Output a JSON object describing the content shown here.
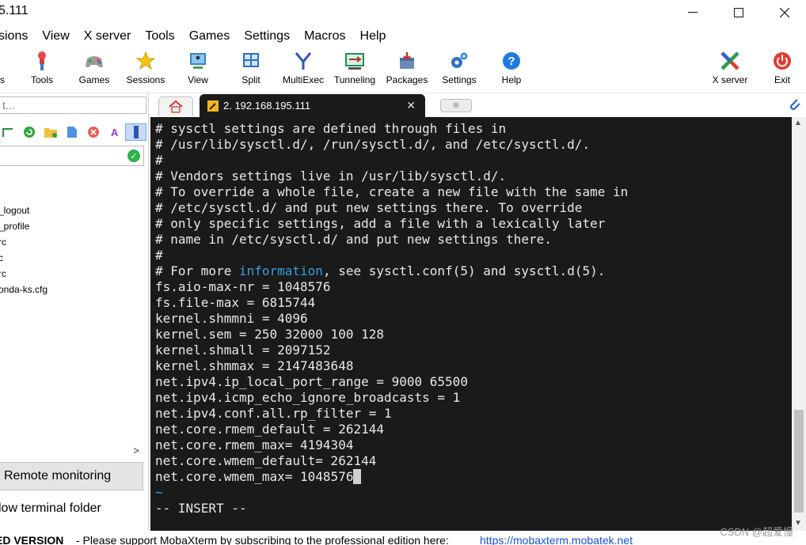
{
  "window": {
    "title": "5.111"
  },
  "menu": [
    "sions",
    "View",
    "X server",
    "Tools",
    "Games",
    "Settings",
    "Macros",
    "Help"
  ],
  "toolbar": {
    "items": [
      {
        "label": "rs",
        "icon": "servers-icon"
      },
      {
        "label": "Tools",
        "icon": "tools-icon"
      },
      {
        "label": "Games",
        "icon": "games-icon"
      },
      {
        "label": "Sessions",
        "icon": "sessions-star-icon"
      },
      {
        "label": "View",
        "icon": "view-icon"
      },
      {
        "label": "Split",
        "icon": "split-icon"
      },
      {
        "label": "MultiExec",
        "icon": "multiexec-icon"
      },
      {
        "label": "Tunneling",
        "icon": "tunneling-icon"
      },
      {
        "label": "Packages",
        "icon": "packages-icon"
      },
      {
        "label": "Settings",
        "icon": "settings-gear-icon"
      },
      {
        "label": "Help",
        "icon": "help-icon"
      }
    ],
    "right": [
      {
        "label": "X server",
        "icon": "x-server-icon"
      },
      {
        "label": "Exit",
        "icon": "exit-power-icon"
      }
    ]
  },
  "sidebar": {
    "quick_connect_placeholder": "t...",
    "files": [
      "_logout",
      "_profile",
      "rc",
      "c",
      "rc",
      "onda-ks.cfg"
    ],
    "remote_monitoring": "Remote monitoring",
    "follow_folder": "low terminal folder"
  },
  "tabs": {
    "active_label": "2. 192.168.195.111",
    "close": "✕"
  },
  "terminal": {
    "lines": [
      "# sysctl settings are defined through files in",
      "# /usr/lib/sysctl.d/, /run/sysctl.d/, and /etc/sysctl.d/.",
      "#",
      "# Vendors settings live in /usr/lib/sysctl.d/.",
      "# To override a whole file, create a new file with the same in",
      "# /etc/sysctl.d/ and put new settings there. To override",
      "# only specific settings, add a file with a lexically later",
      "# name in /etc/sysctl.d/ and put new settings there.",
      "#",
      "fs.aio-max-nr = 1048576",
      "fs.file-max = 6815744",
      "kernel.shmmni = 4096",
      "kernel.sem = 250 32000 100 128",
      "kernel.shmall = 2097152",
      "kernel.shmmax = 2147483648",
      "net.ipv4.ip_local_port_range = 9000 65500",
      "net.ipv4.icmp_echo_ignore_broadcasts = 1",
      "net.ipv4.conf.all.rp_filter = 1",
      "net.core.rmem_default = 262144",
      "net.core.rmem_max= 4194304",
      "net.core.wmem_default= 262144",
      "net.core.wmem_max= 1048576"
    ],
    "info_line": {
      "prefix": "# For more ",
      "keyword": "information",
      "suffix": ", see sysctl.conf(5) and sysctl.d(5)."
    },
    "tilde": "~",
    "mode": "-- INSERT --"
  },
  "status": {
    "bold": "ED VERSION",
    "message": "-  Please support MobaXterm by subscribing to the professional edition here:",
    "link": "https://mobaxterm.mobatek.net"
  },
  "watermark": "CSDN @超爱慢",
  "colors": {
    "terminal_bg": "#1a1a1a",
    "keyword": "#3b9ddd",
    "link": "#1a4fd6"
  }
}
